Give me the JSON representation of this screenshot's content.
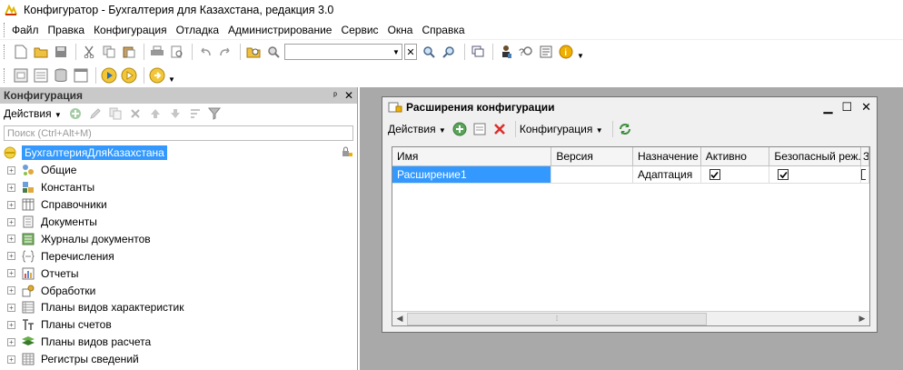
{
  "window": {
    "title": "Конфигуратор - Бухгалтерия для Казахстана, редакция 3.0"
  },
  "menu": [
    "Файл",
    "Правка",
    "Конфигурация",
    "Отладка",
    "Администрирование",
    "Сервис",
    "Окна",
    "Справка"
  ],
  "toolbar": {
    "search_value": ""
  },
  "left_panel": {
    "title": "Конфигурация",
    "pin": "ᵖ",
    "close": "✕",
    "actions_label": "Действия",
    "search_placeholder": "Поиск (Ctrl+Alt+M)",
    "root": "БухгалтерияДляКазахстана",
    "items": [
      {
        "label": "Общие",
        "icon": "common-icon"
      },
      {
        "label": "Константы",
        "icon": "constants-icon"
      },
      {
        "label": "Справочники",
        "icon": "catalogs-icon"
      },
      {
        "label": "Документы",
        "icon": "documents-icon"
      },
      {
        "label": "Журналы документов",
        "icon": "journals-icon"
      },
      {
        "label": "Перечисления",
        "icon": "enums-icon"
      },
      {
        "label": "Отчеты",
        "icon": "reports-icon"
      },
      {
        "label": "Обработки",
        "icon": "dataprocessors-icon"
      },
      {
        "label": "Планы видов характеристик",
        "icon": "chart-of-characteristic-types-icon"
      },
      {
        "label": "Планы счетов",
        "icon": "chart-of-accounts-icon"
      },
      {
        "label": "Планы видов расчета",
        "icon": "chart-of-calculation-types-icon"
      },
      {
        "label": "Регистры сведений",
        "icon": "information-registers-icon"
      }
    ]
  },
  "ext_window": {
    "title": "Расширения конфигурации",
    "actions_label": "Действия",
    "config_label": "Конфигурация",
    "columns": [
      "Имя",
      "Версия",
      "Назначение",
      "Активно",
      "Безопасный реж...",
      "З"
    ],
    "rows": [
      {
        "name": "Расширение1",
        "version": "",
        "purpose": "Адаптация",
        "active": true,
        "safe_mode": true
      }
    ]
  },
  "colors": {
    "selection": "#3399ff",
    "mdi_background": "#a9a9a9",
    "panel_header": "#c9c9c9"
  }
}
